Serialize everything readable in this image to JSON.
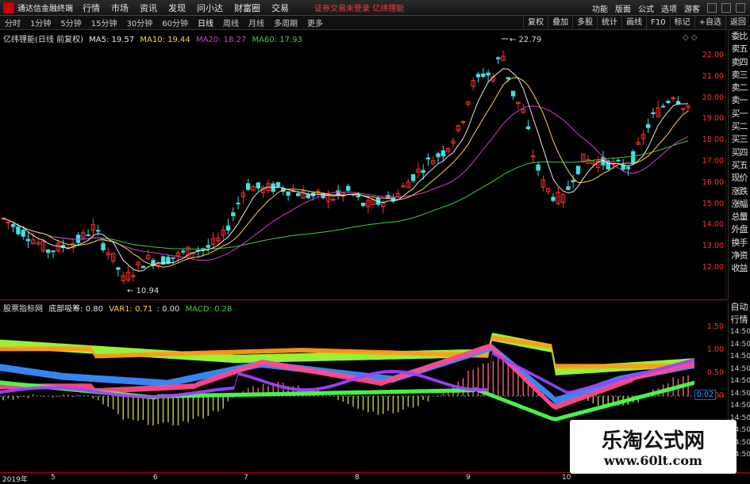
{
  "menubar": {
    "app_name": "通达信金融终端",
    "items": [
      "行情",
      "市场",
      "资讯",
      "发现",
      "问小达",
      "财富圈",
      "交易"
    ],
    "notice": "证券交易未登录  亿纬锂能",
    "right_items": [
      "功能",
      "版面",
      "公式",
      "选项",
      "游客"
    ]
  },
  "tabbar": {
    "periods": [
      "分时",
      "1分钟",
      "5分钟",
      "15分钟",
      "30分钟",
      "60分钟",
      "日线",
      "周线",
      "月线",
      "多周期",
      "更多"
    ],
    "active_period": "日线",
    "right_buttons": [
      "复权",
      "叠加",
      "多股",
      "统计",
      "画线",
      "F10",
      "标记",
      "+自选",
      "返回"
    ]
  },
  "main_legend": {
    "title": "亿纬锂能(日线 前复权)",
    "ma5": "MA5: 19.57",
    "ma10": "MA10: 19.44",
    "ma20": "MA20: 18.27",
    "ma60": "MA60: 17.93",
    "colors": {
      "ma5": "#e8e8e8",
      "ma10": "#ffd24a",
      "ma20": "#d040d0",
      "ma60": "#40d040"
    }
  },
  "main_axis": [
    "22.00",
    "21.00",
    "20.00",
    "19.00",
    "18.00",
    "17.00",
    "16.00",
    "15.00",
    "14.00",
    "13.00",
    "12.00"
  ],
  "price_labels": {
    "high": "22.79",
    "low": "10.94"
  },
  "sub_legend": {
    "title": "股票指标网",
    "name": "底部吸筹: 0.80",
    "var1": "VAR1: 0.71",
    "zero": ": 0.00",
    "macd": "MACD: 0.28"
  },
  "sub_axis": [
    "1.50",
    "1.00",
    "0.50",
    "0.00"
  ],
  "sub_value": "0.02",
  "side_panel": {
    "top": [
      "委比",
      "卖五",
      "卖四",
      "卖三",
      "卖二",
      "卖一",
      "买一",
      "买二",
      "买三",
      "买四",
      "买五",
      "现价",
      "涨跌",
      "涨幅",
      "总量",
      "外盘",
      "换手",
      "净资",
      "收益"
    ],
    "bottom_label": [
      "自动",
      "行情"
    ],
    "times": [
      "14:50",
      "14:50",
      "14:50",
      "14:50",
      "14:50",
      "14:50",
      "14:50",
      "14:50",
      "14:50",
      "14:50",
      "14:50"
    ]
  },
  "dates": [
    "2019年",
    "5",
    "6",
    "7",
    "8",
    "9",
    "10"
  ],
  "watermark": {
    "line1": "乐淘公式网",
    "line2": "www.60lt.com"
  },
  "chart_data": {
    "type": "candlestick",
    "ylim": [
      10.5,
      23.2
    ],
    "ma_values": {
      "MA5": 19.57,
      "MA10": 19.44,
      "MA20": 18.27,
      "MA60": 17.93
    }
  }
}
